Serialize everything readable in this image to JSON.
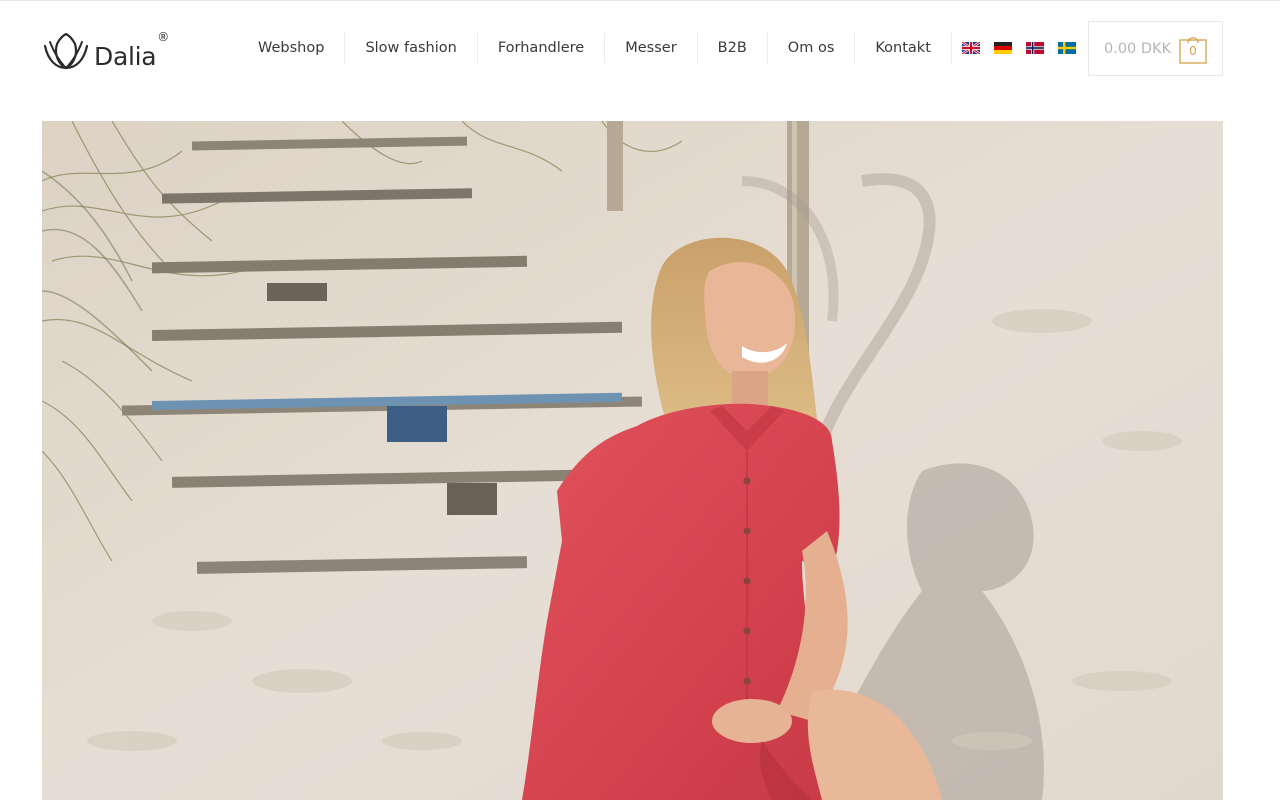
{
  "brand": {
    "name": "Dalia",
    "registered": "®",
    "logo_icon": "lotus-outline-icon"
  },
  "nav": {
    "items": [
      {
        "label": "Webshop"
      },
      {
        "label": "Slow fashion"
      },
      {
        "label": "Forhandlere"
      },
      {
        "label": "Messer"
      },
      {
        "label": "B2B"
      },
      {
        "label": "Om os"
      },
      {
        "label": "Kontakt"
      }
    ],
    "languages": [
      {
        "code": "en",
        "icon": "flag-uk-icon"
      },
      {
        "code": "de",
        "icon": "flag-germany-icon"
      },
      {
        "code": "no",
        "icon": "flag-norway-icon"
      },
      {
        "code": "sv",
        "icon": "flag-sweden-icon"
      }
    ]
  },
  "cart": {
    "amount": "0.00 DKK",
    "count": "0",
    "icon": "shopping-bag-icon",
    "accent": "#d4a24a"
  },
  "hero": {
    "image": "woman-in-red-linen-dress-on-sand-dune-photo"
  },
  "colors": {
    "dress": "#d94a55",
    "sand": "#e4dcd3",
    "text": "#3a3a3a"
  }
}
